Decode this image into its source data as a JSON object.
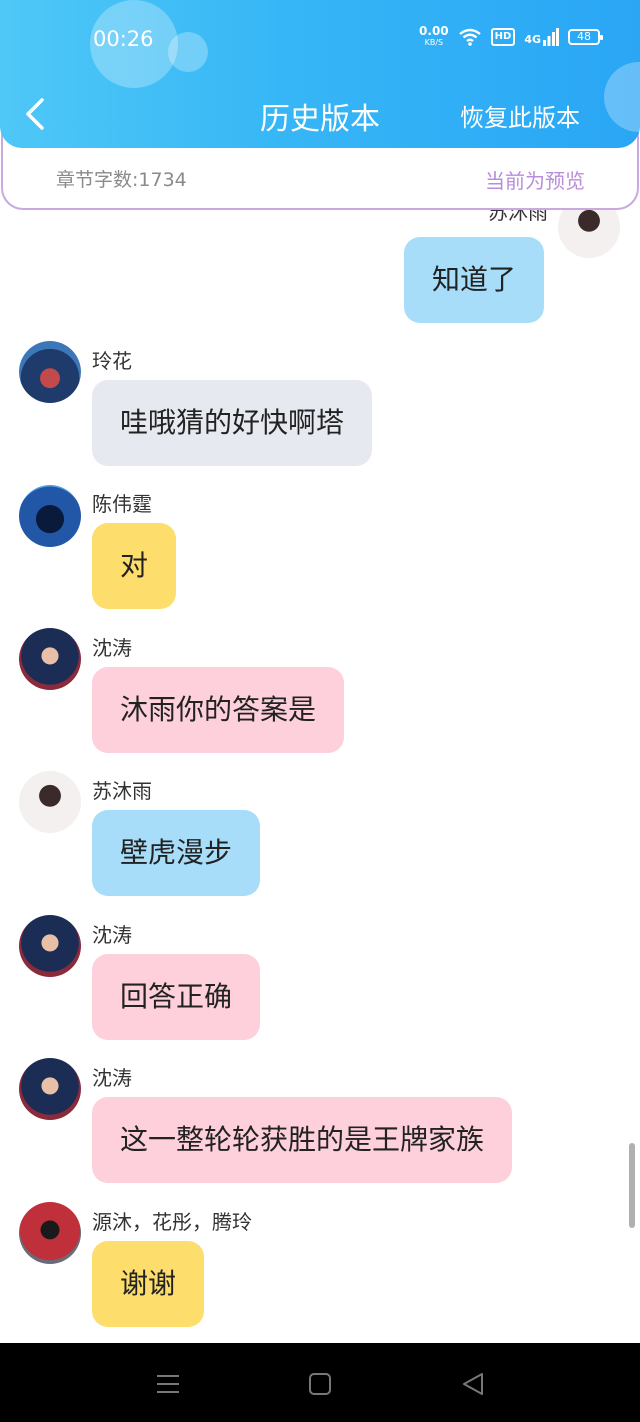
{
  "status_bar": {
    "time": "00:26",
    "net_speed": "0.00",
    "net_unit": "KB/S",
    "hd": "HD",
    "signal": "4G",
    "battery": "48"
  },
  "header": {
    "title": "历史版本",
    "restore_label": "恢复此版本"
  },
  "subbar": {
    "word_count": "章节字数:1734",
    "preview_label": "当前为预览"
  },
  "messages": [
    {
      "side": "right",
      "name": "苏沐雨",
      "text": "知道了",
      "color": "#a8ddfa"
    },
    {
      "side": "left",
      "name": "玲花",
      "text": "哇哦猜的好快啊塔",
      "color": "#e6e9ef"
    },
    {
      "side": "left",
      "name": "陈伟霆",
      "text": "对",
      "color": "#fddd6b"
    },
    {
      "side": "left",
      "name": "沈涛",
      "text": "沐雨你的答案是",
      "color": "#fdd0dc"
    },
    {
      "side": "left",
      "name": "苏沐雨",
      "text": "壁虎漫步",
      "color": "#a8ddfa"
    },
    {
      "side": "left",
      "name": "沈涛",
      "text": "回答正确",
      "color": "#fdd0dc"
    },
    {
      "side": "left",
      "name": "沈涛",
      "text": "这一整轮轮获胜的是王牌家族",
      "color": "#fdd0dc"
    },
    {
      "side": "left",
      "name": "源沐，花彤，腾玲",
      "text": "谢谢",
      "color": "#fddd6b"
    }
  ],
  "nav": {
    "icons": [
      "menu-icon",
      "home-icon",
      "back-triangle-icon"
    ]
  }
}
